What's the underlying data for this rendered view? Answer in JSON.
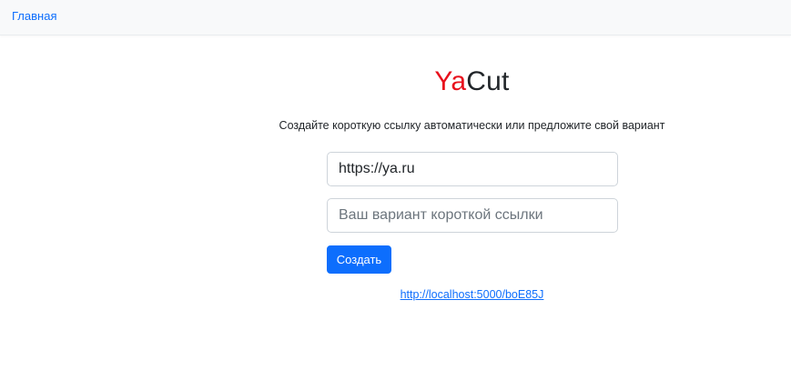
{
  "navbar": {
    "home_label": "Главная"
  },
  "logo": {
    "part1": "Ya",
    "part2": "Cut",
    "colors": {
      "part1": "#e8101c",
      "part2": "#212529"
    }
  },
  "subtitle": "Создайте короткую ссылку автоматически или предложите свой вариант",
  "form": {
    "original_link": {
      "value": "https://ya.ru",
      "placeholder": ""
    },
    "custom_id": {
      "value": "",
      "placeholder": "Ваш вариант короткой ссылки"
    },
    "submit_label": "Создать"
  },
  "result": {
    "short_link": "http://localhost:5000/boE85J"
  },
  "colors": {
    "accent": "#0d6efd",
    "navbar_bg": "#f8f9fa"
  }
}
